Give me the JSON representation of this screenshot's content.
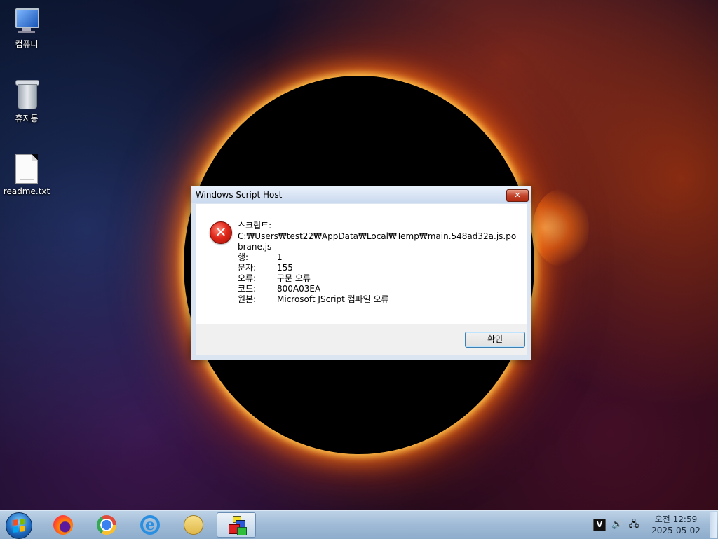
{
  "desktop": {
    "icons": [
      {
        "label": "컴퓨터",
        "icon": "computer-icon"
      },
      {
        "label": "휴지통",
        "icon": "recycle-bin-icon"
      },
      {
        "label": "readme.txt",
        "icon": "text-file-icon"
      }
    ]
  },
  "dialog": {
    "title": "Windows Script Host",
    "close_glyph": "✕",
    "icon": "error-icon",
    "icon_glyph": "✕",
    "script_label": "스크립트:",
    "script_path": "C:₩Users₩test22₩AppData₩Local₩Temp₩main.548ad32a.js.pobrane.js",
    "fields": [
      {
        "label": "행:",
        "value": "1"
      },
      {
        "label": "문자:",
        "value": "155"
      },
      {
        "label": "오류:",
        "value": "구문 오류"
      },
      {
        "label": "코드:",
        "value": "800A03EA"
      },
      {
        "label": "원본:",
        "value": "Microsoft JScript 컴파일 오류"
      }
    ],
    "ok_label": "확인"
  },
  "taskbar": {
    "apps": [
      {
        "name": "firefox",
        "icon": "firefox-icon"
      },
      {
        "name": "chrome",
        "icon": "chrome-icon"
      },
      {
        "name": "internet-explorer",
        "icon": "ie-icon"
      },
      {
        "name": "file-explorer",
        "icon": "folder-icon"
      },
      {
        "name": "windows-script-host",
        "icon": "script-host-icon",
        "active": true
      }
    ],
    "tray": {
      "vm_glyph": "V",
      "volume_glyph": "🔊",
      "network_glyph": "🖧"
    },
    "clock": {
      "time": "오전 12:59",
      "date": "2025-05-02"
    }
  }
}
